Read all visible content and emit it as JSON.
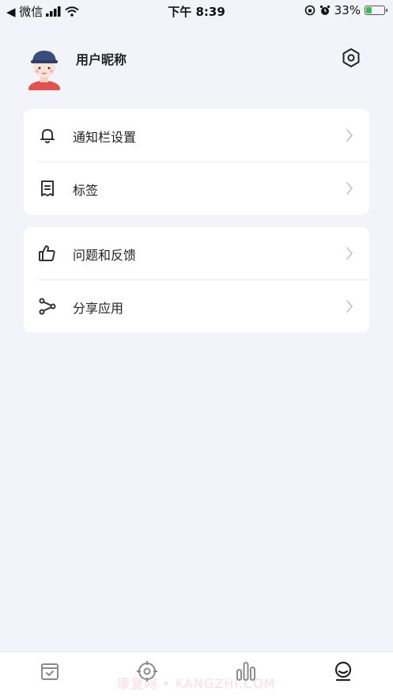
{
  "status_bar": {
    "back_app": "◀ 微信",
    "time": "下午 8:39",
    "battery_percent": "33%",
    "battery_level": 0.33
  },
  "profile": {
    "nickname": "用户昵称"
  },
  "menu": {
    "group1": [
      {
        "label": "通知栏设置",
        "icon": "bell-icon"
      },
      {
        "label": "标签",
        "icon": "note-icon"
      }
    ],
    "group2": [
      {
        "label": "问题和反馈",
        "icon": "thumbs-up-icon"
      },
      {
        "label": "分享应用",
        "icon": "share-icon"
      }
    ]
  },
  "tabbar": {
    "tabs": [
      "checklist-icon",
      "target-icon",
      "chart-icon",
      "profile-icon"
    ],
    "active": 3
  },
  "watermark": "康复网 • KANGZHI.COM",
  "colors": {
    "background": "#f3f4f9",
    "card": "#ffffff",
    "text": "#222222",
    "chevron": "#c8c8c8",
    "icon": "#333333"
  }
}
